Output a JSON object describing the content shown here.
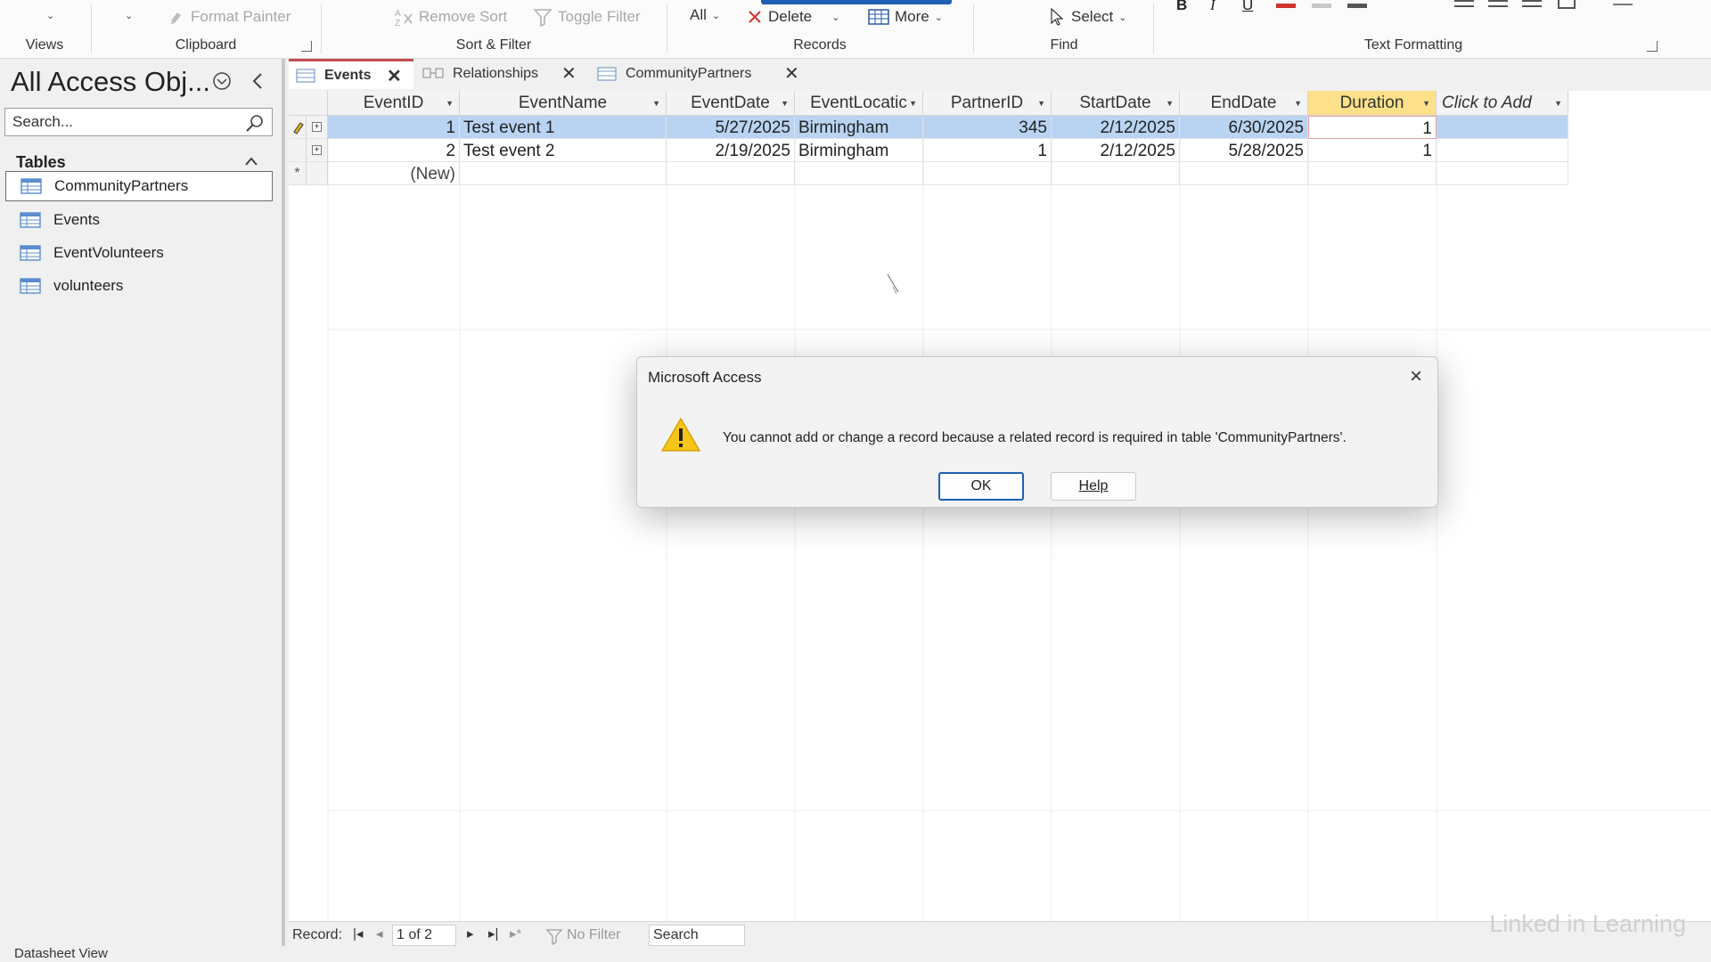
{
  "ribbon": {
    "groups": [
      {
        "label": "Views"
      },
      {
        "label": "Clipboard"
      },
      {
        "label": "Sort & Filter"
      },
      {
        "label": "Records"
      },
      {
        "label": "Find"
      },
      {
        "label": "Text Formatting"
      }
    ],
    "format_painter": "Format Painter",
    "remove_sort": "Remove Sort",
    "toggle_filter": "Toggle Filter",
    "all": "All",
    "delete": "Delete",
    "more": "More",
    "select": "Select"
  },
  "nav": {
    "title": "All Access Obj...",
    "search_placeholder": "Search...",
    "section": "Tables",
    "items": [
      {
        "label": "CommunityPartners"
      },
      {
        "label": "Events"
      },
      {
        "label": "EventVolunteers"
      },
      {
        "label": "volunteers"
      }
    ]
  },
  "tabs": [
    {
      "label": "Events"
    },
    {
      "label": "Relationships"
    },
    {
      "label": "CommunityPartners"
    }
  ],
  "table": {
    "columns": [
      "EventID",
      "EventName",
      "EventDate",
      "EventLocatic",
      "PartnerID",
      "StartDate",
      "EndDate",
      "Duration",
      "Click to Add"
    ],
    "rows": [
      [
        "1",
        "Test event 1",
        "5/27/2025",
        "Birmingham",
        "345",
        "2/12/2025",
        "6/30/2025",
        "1",
        ""
      ],
      [
        "2",
        "Test event 2",
        "2/19/2025",
        "Birmingham",
        "1",
        "2/12/2025",
        "5/28/2025",
        "1",
        ""
      ]
    ],
    "new_row": "(New)"
  },
  "record_nav": {
    "label": "Record:",
    "position": "1 of 2",
    "no_filter": "No Filter",
    "search": "Search"
  },
  "status": {
    "view": "Datasheet View"
  },
  "dialog": {
    "title": "Microsoft Access",
    "message": "You cannot add or change a record because a related record is required in table 'CommunityPartners'.",
    "ok": "OK",
    "help": "Help"
  },
  "watermark": "Linked in Learning",
  "colors": {
    "accent_tab": "#c0504d",
    "selection": "#b9d4f2",
    "highlight_col": "#fce08a",
    "warning": "#f5c518"
  }
}
